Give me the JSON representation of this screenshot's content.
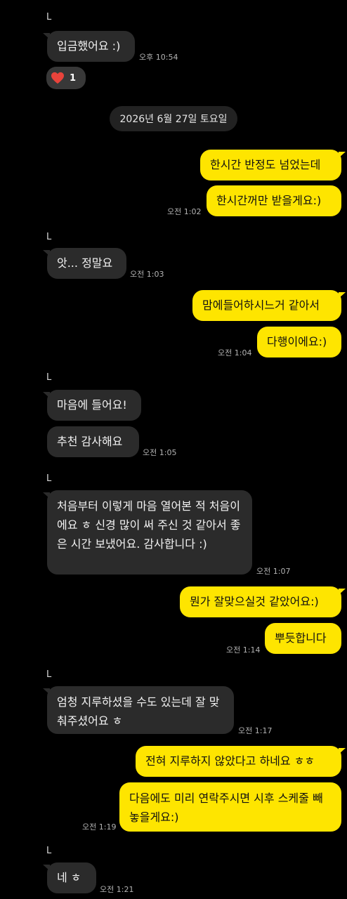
{
  "colors": {
    "background": "#000000",
    "incoming_bubble": "#2b2b2b",
    "outgoing_bubble": "#fee500",
    "heart": "#e8433b"
  },
  "messages": [
    {
      "sender": "L",
      "text": "입금했어요 :)",
      "time": "오후 10:54"
    },
    {
      "reaction": {
        "icon": "heart-icon",
        "count": "1"
      }
    },
    {
      "date_divider": "2026년 6월 27일 토요일"
    },
    {
      "text": "한시간 반정도 넘었는데"
    },
    {
      "text": "한시간꺼만 받을게요:)",
      "time": "오전 1:02"
    },
    {
      "sender": "L",
      "text": "앗... 정말요",
      "time": "오전 1:03"
    },
    {
      "text": "맘에들어하시느거 같아서"
    },
    {
      "text": "다행이에요:)",
      "time": "오전 1:04"
    },
    {
      "sender": "L",
      "text": "마음에 들어요!"
    },
    {
      "text": "추천 감사해요",
      "time": "오전 1:05"
    },
    {
      "sender": "L",
      "text": "처음부터 이렇게 마음 열어본 적 처음이에요 ㅎ 신경 많이 써 주신 것 같아서 좋은 시간 보냈어요. 감사합니다 :)",
      "time": "오전 1:07"
    },
    {
      "text": "뭔가 잘맞으실것 같았어요:)"
    },
    {
      "text": "뿌듯합니다",
      "time": "오전 1:14"
    },
    {
      "sender": "L",
      "text": "엄청 지루하셨을 수도 있는데 잘 맞춰주셨어요 ㅎ",
      "time": "오전 1:17"
    },
    {
      "text": "전혀 지루하지 않았다고 하네요 ㅎㅎ"
    },
    {
      "text": "다음에도 미리 연락주시면 시후 스케줄 빼놓을게요:)",
      "time": "오전 1:19"
    },
    {
      "sender": "L",
      "text": "네 ㅎ",
      "time": "오전 1:21"
    }
  ]
}
